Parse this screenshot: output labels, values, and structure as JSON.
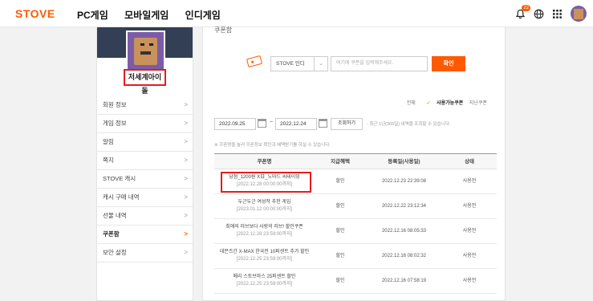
{
  "header": {
    "logo": "STOVE",
    "nav": [
      "PC게임",
      "모바일게임",
      "인디게임"
    ],
    "notification_count": "22",
    "icons": [
      "bell-icon",
      "globe-icon",
      "grid-icon"
    ]
  },
  "sidebar": {
    "nickname": "저세계아이돌",
    "items": [
      {
        "label": "회원 정보"
      },
      {
        "label": "게임 정보"
      },
      {
        "label": "알림"
      },
      {
        "label": "쪽지"
      },
      {
        "label": "STOVE 캐시"
      },
      {
        "label": "캐시 구매 내역"
      },
      {
        "label": "선물 내역"
      },
      {
        "label": "쿠폰함"
      },
      {
        "label": "보안 설정"
      }
    ]
  },
  "main": {
    "section_title": "쿠폰함",
    "platform_select": "STOVE 인디",
    "coupon_placeholder": "여기에 쿠폰을 입력해주세요.",
    "confirm_label": "확인",
    "filter_tabs": {
      "all": "전체",
      "usable": "사용가능쿠폰",
      "expired": "지난쿠폰"
    },
    "date_from": "2022.09.25",
    "date_to": "2022.12.24",
    "search_label": "조회하기",
    "range_note": "- 최근 1년(365일) 내역을 조회할 수 있습니다.",
    "help_note": "※ 쿠폰명을 눌러 쿠폰정보 확인과 혜택받기를 하실 수 있습니다.",
    "columns": [
      "쿠폰명",
      "지급혜택",
      "등록일(사용일)",
      "상태"
    ],
    "rows": [
      {
        "name": "당첨_1200원 X日_노마드 씨테이밍",
        "expires": "[2022.12.28 00:00:00까지]",
        "benefit": "할인",
        "date": "2022.12.23 22:39:08",
        "status": "사용전"
      },
      {
        "name": "두근두근 여성작 추천 게임",
        "expires": "[2023.01.12 00:00:00까지]",
        "benefit": "할인",
        "date": "2022.12.22 23:12:34",
        "status": "사용전"
      },
      {
        "name": "최애의 러브보다 사랑의 러브! 할인쿠폰",
        "expires": "[2022.12.28 23:59:00까지]",
        "benefit": "할인",
        "date": "2022.12.16 08:05:33",
        "status": "사용전"
      },
      {
        "name": "데믄즈간 X-MAX 한국전 10퍼센트 추가 할인",
        "expires": "[2022.12.25 23:59:00까지]",
        "benefit": "할인",
        "date": "2022.12.16 08:02:32",
        "status": "사용전"
      },
      {
        "name": "메리 스토브마스 25퍼센트 할인",
        "expires": "[2022.12.25 23:59:00까지]",
        "benefit": "할인",
        "date": "2022.12.16 07:58:19",
        "status": "사용전"
      }
    ]
  },
  "colors": {
    "accent": "#ff5a00",
    "highlight": "#e41d1d"
  }
}
